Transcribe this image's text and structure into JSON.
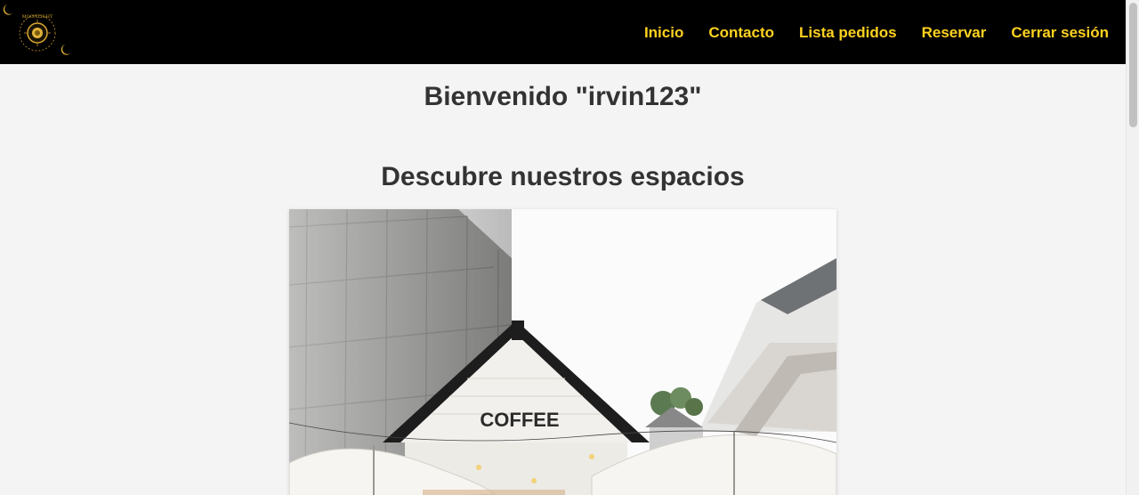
{
  "header": {
    "logo_text": "MOONLIGHT",
    "nav": [
      {
        "label": "Inicio"
      },
      {
        "label": "Contacto"
      },
      {
        "label": "Lista pedidos"
      },
      {
        "label": "Reservar"
      },
      {
        "label": "Cerrar sesión"
      }
    ]
  },
  "main": {
    "welcome": "Bienvenido \"irvin123\"",
    "section_title": "Descubre nuestros espacios",
    "hero_sign": "COFFEE"
  },
  "colors": {
    "header_bg": "#000000",
    "nav_text": "#ffd21f",
    "page_bg": "#f4f4f4",
    "heading_text": "#333333"
  }
}
